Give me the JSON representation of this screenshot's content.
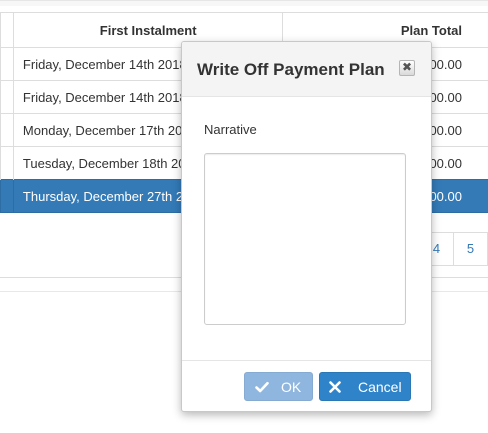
{
  "table": {
    "headers": {
      "first_instalment": "First Instalment",
      "plan_total": "Plan Total"
    },
    "rows": [
      {
        "first_instalment": "Friday, December 14th 2018",
        "plan_total": "00.00"
      },
      {
        "first_instalment": "Friday, December 14th 2018",
        "plan_total": "00.00"
      },
      {
        "first_instalment": "Monday, December 17th 2018",
        "plan_total": "00.00"
      },
      {
        "first_instalment": "Tuesday, December 18th 2018",
        "plan_total": "00.00"
      },
      {
        "first_instalment": "Thursday, December 27th 2018",
        "plan_total": "00.00"
      }
    ],
    "selected_row_index": 4
  },
  "pagination": {
    "pages": [
      "4",
      "5"
    ]
  },
  "modal": {
    "title": "Write Off Payment Plan",
    "close_icon": "close-icon",
    "narrative_label": "Narrative",
    "narrative_value": "",
    "ok_label": "OK",
    "cancel_label": "Cancel",
    "ok_icon": "check-icon",
    "cancel_icon": "x-icon"
  },
  "colors": {
    "selected_row": "#337ab7",
    "ok_button": "#8fb6de",
    "cancel_button": "#2f84c9",
    "link": "#337ab7"
  }
}
